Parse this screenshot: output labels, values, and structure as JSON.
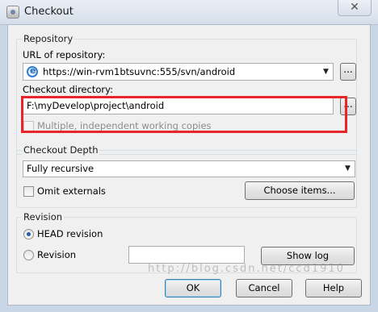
{
  "window": {
    "title": "Checkout",
    "close_symbol": "✕"
  },
  "repository": {
    "group_label": "Repository",
    "url_label": "URL of repository:",
    "url_value": "https://win-rvm1btsuvnc:555/svn/android",
    "browse_label": "...",
    "dir_label": "Checkout directory:",
    "dir_value": "F:\\myDevelop\\project\\android",
    "dir_browse_label": "...",
    "multiple_wc_label": "Multiple, independent working copies"
  },
  "depth": {
    "group_label": "Checkout Depth",
    "value": "Fully recursive",
    "omit_externals_label": "Omit externals",
    "choose_items_label": "Choose items..."
  },
  "revision": {
    "group_label": "Revision",
    "head_label": "HEAD revision",
    "revision_label": "Revision",
    "revision_value": "",
    "show_log_label": "Show log"
  },
  "buttons": {
    "ok": "OK",
    "cancel": "Cancel",
    "help": "Help"
  },
  "watermark": "http://blog.csdn.net/ccd1910",
  "colors": {
    "highlight": "#e8252a",
    "group_border": "#d5dfe5"
  },
  "icons": {
    "app": "tortoisesvn-icon",
    "url": "ie-icon",
    "dropdown": "chevron-down-icon"
  }
}
